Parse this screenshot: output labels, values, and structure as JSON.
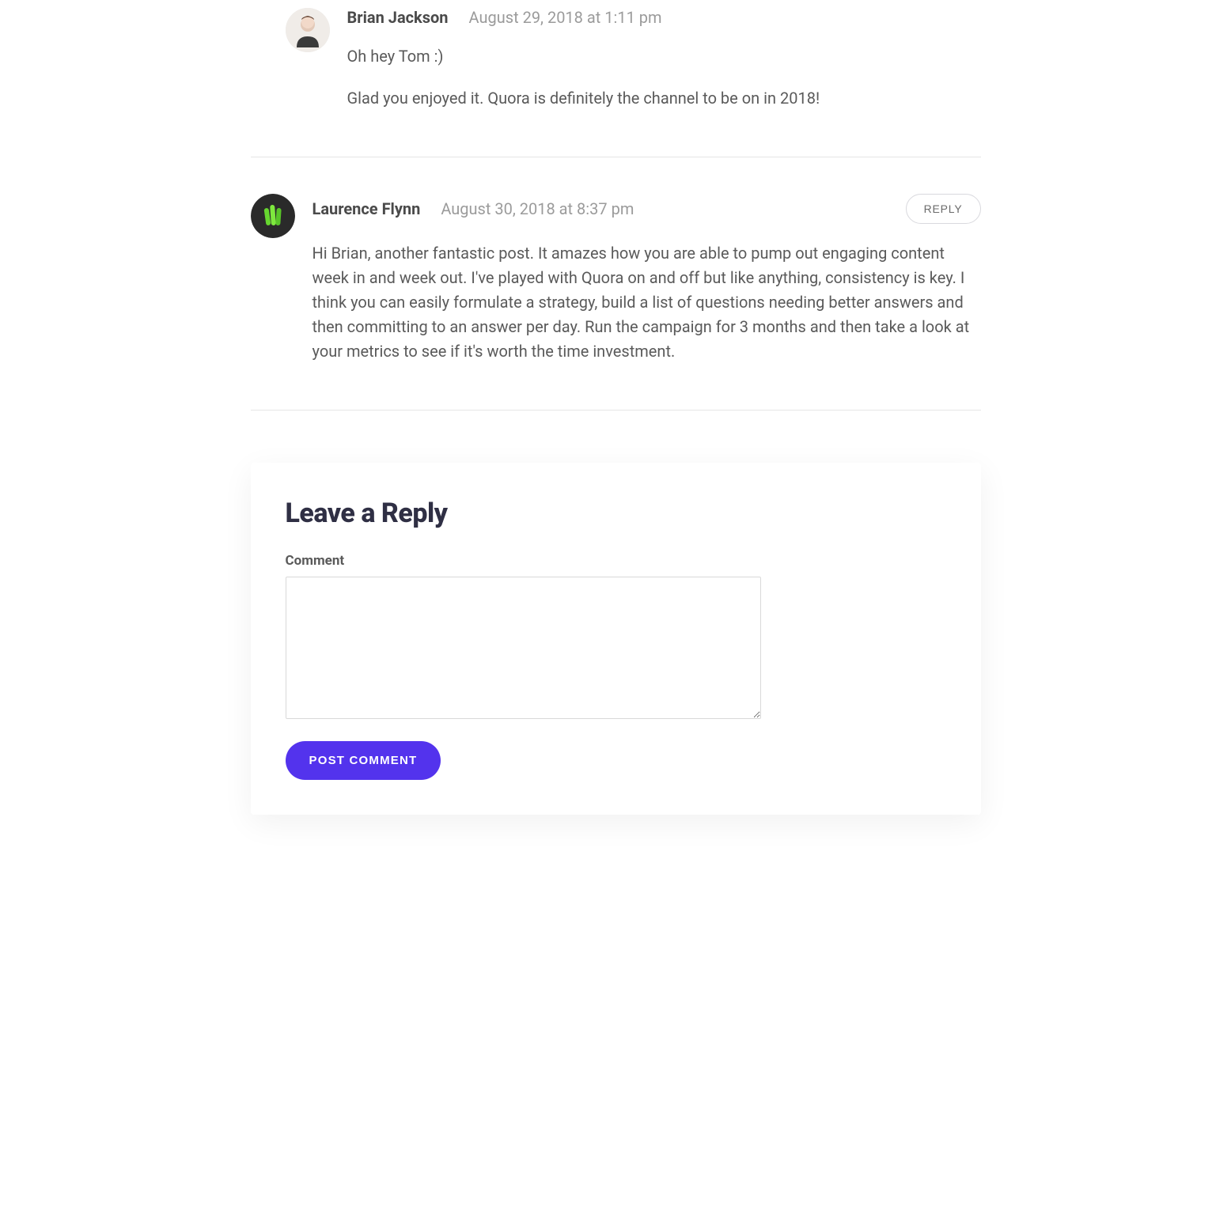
{
  "comments": [
    {
      "author": "Brian Jackson",
      "date": "August 29, 2018 at 1:11 pm",
      "paragraphs": [
        "Oh hey Tom :)",
        "Glad you enjoyed it. Quora is definitely the channel to be on in 2018!"
      ],
      "avatar": "person"
    },
    {
      "author": "Laurence Flynn",
      "date": "August 30, 2018 at 8:37 pm",
      "paragraphs": [
        "Hi Brian, another fantastic post. It amazes how you are able to pump out engaging content week in and week out. I've played with Quora on and off but like anything, consistency is key. I think you can easily formulate a strategy, build a list of questions needing better answers and then committing to an answer per day. Run the campaign for 3 months and then take a look at your metrics to see if it's worth the time investment."
      ],
      "avatar": "green",
      "reply_label": "REPLY"
    }
  ],
  "reply_form": {
    "title": "Leave a Reply",
    "comment_label": "Comment",
    "submit_label": "POST COMMENT"
  }
}
